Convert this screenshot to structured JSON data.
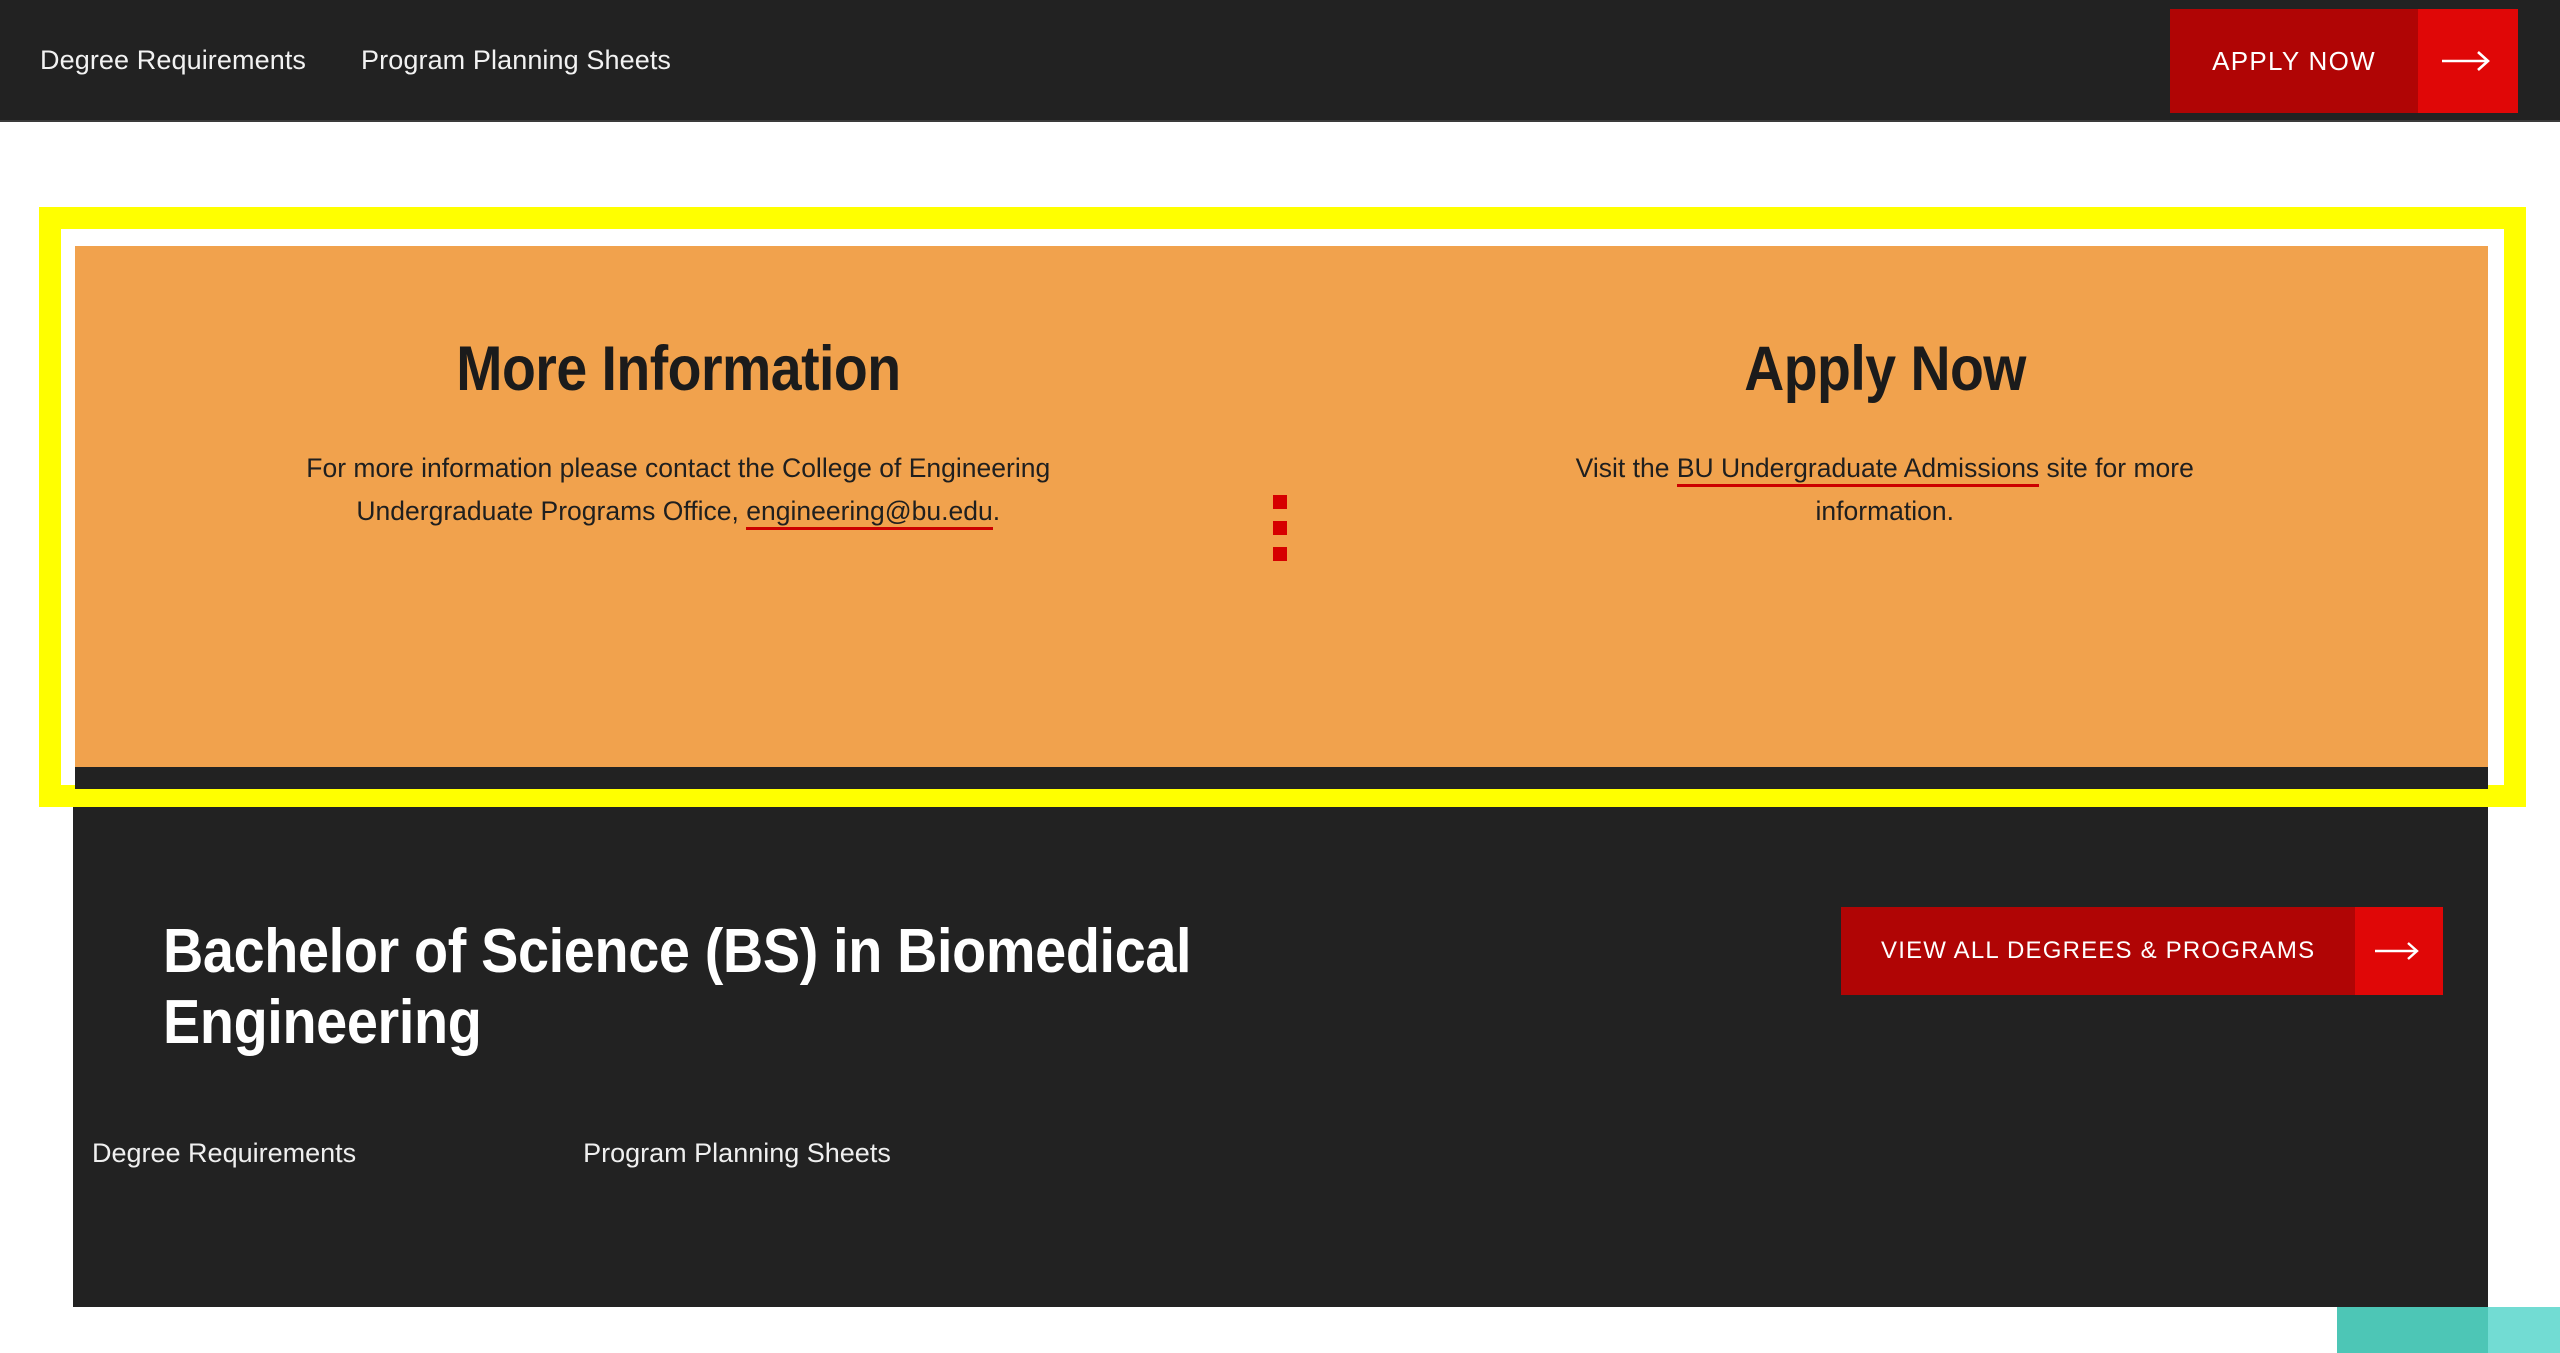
{
  "topbar": {
    "links": [
      {
        "label": "Degree Requirements"
      },
      {
        "label": "Program Planning Sheets"
      }
    ],
    "apply_button": {
      "label": "APPLY NOW",
      "arrow": "arrow-right-icon"
    },
    "background_color": "#222222",
    "button_color": "#b00505",
    "button_arrow_color": "#e00707"
  },
  "highlight": {
    "border_color": "#ffff00",
    "inner_color": "#ffffff"
  },
  "promo": {
    "background_color": "#f1a24d",
    "columns": [
      {
        "heading": "More Information",
        "body_before": "For more information please contact the College of Engineering Undergraduate Programs Office, ",
        "link": "engineering@bu.edu",
        "body_after": "."
      },
      {
        "heading": "Apply Now",
        "body_before": "Visit the ",
        "link": "BU Undergraduate Admissions",
        "body_after": " site for more information."
      }
    ],
    "divider": {
      "dot_color": "#d60000",
      "dot_count": 3
    },
    "link_underline_color": "#cc0000"
  },
  "degree": {
    "title": "Bachelor of Science (BS) in Biomedical Engineering",
    "view_all_button": {
      "label": "VIEW ALL DEGREES & PROGRAMS",
      "arrow": "arrow-right-icon"
    },
    "links": [
      {
        "label": "Degree Requirements"
      },
      {
        "label": "Program Planning Sheets"
      }
    ],
    "background_color": "#222222"
  },
  "footer_accents": {
    "teal_dark": "#4dc6b6",
    "teal_light": "#72dcd3"
  }
}
